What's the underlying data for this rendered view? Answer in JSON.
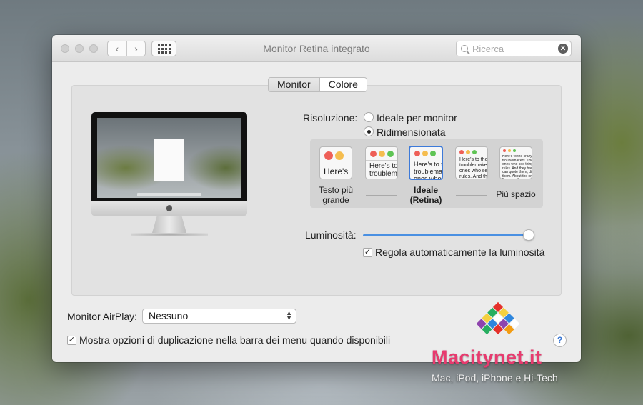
{
  "window": {
    "title": "Monitor Retina integrato"
  },
  "toolbar": {
    "back": "‹",
    "forward": "›",
    "search_placeholder": "Ricerca",
    "search_clear": "✕"
  },
  "tabs": [
    {
      "label": "Monitor",
      "active": true
    },
    {
      "label": "Colore",
      "active": false
    }
  ],
  "resolution": {
    "label": "Risoluzione:",
    "options": [
      {
        "label": "Ideale per monitor",
        "selected": false
      },
      {
        "label": "Ridimensionata",
        "selected": true
      }
    ],
    "thumbnails": [
      {
        "text": "Here's",
        "caption": "Testo più\ngrande"
      },
      {
        "text": "Here's to th\ntroublema",
        "caption": ""
      },
      {
        "text": "Here's to th\ntroublemak\nones who",
        "caption": "Ideale\n(Retina)",
        "selected": true
      },
      {
        "text": "Here's to the cr\ntroublemakers.\nones who see t\nrules. And they",
        "caption": ""
      },
      {
        "text": "Here's to the crazy one\ntroublemakers. The rou\nones who see things di\nrules. And they have no\ncan quote them, disagre\nthem. About the only thi\nBecause they change th",
        "caption": "Più spazio"
      }
    ]
  },
  "brightness": {
    "label": "Luminosità:",
    "value": 0.98,
    "auto_label": "Regola automaticamente la luminosità",
    "auto_checked": true
  },
  "airplay": {
    "label": "Monitor AirPlay:",
    "value": "Nessuno"
  },
  "mirroring": {
    "label": "Mostra opzioni di duplicazione nella barra dei menu quando disponibili",
    "checked": true
  },
  "help": {
    "label": "?"
  },
  "watermark": {
    "name": "Macitynet.it",
    "tagline": "Mac, iPod, iPhone e Hi-Tech"
  },
  "colors": {
    "accent": "#3d7ad9",
    "slider": "#4a90e2",
    "red": "#ee5f57",
    "yellow": "#f5bd4f",
    "green": "#5fc455",
    "watermark": "#e83a6e"
  }
}
